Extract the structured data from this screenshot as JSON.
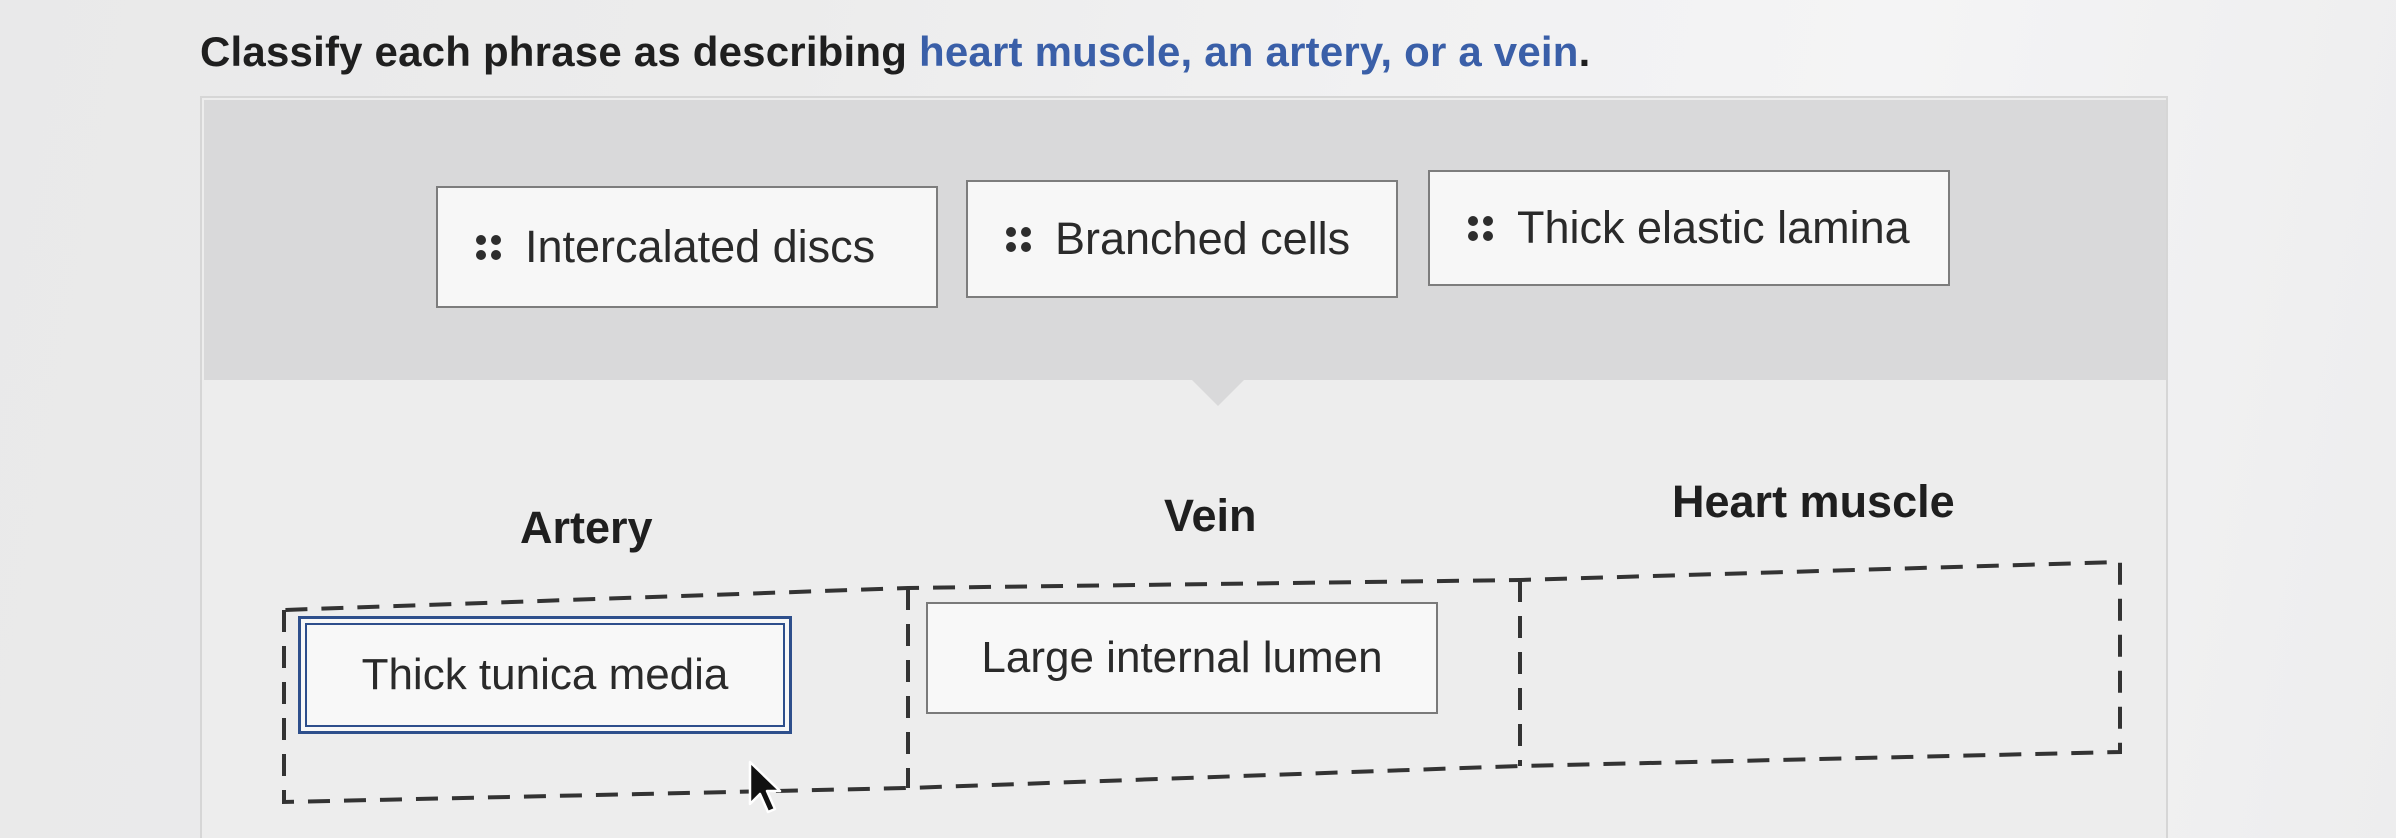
{
  "question": {
    "prefix": "Classify each phrase as describing ",
    "highlight": "heart muscle, an artery, or a vein",
    "suffix": "."
  },
  "word_bank": {
    "items": [
      {
        "label": "Intercalated discs",
        "icon": "drag-handle-icon"
      },
      {
        "label": "Branched cells",
        "icon": "drag-handle-icon"
      },
      {
        "label": "Thick elastic lamina",
        "icon": "drag-handle-icon"
      }
    ]
  },
  "categories": [
    {
      "label": "Artery",
      "placed": [
        "Thick tunica media"
      ]
    },
    {
      "label": "Vein",
      "placed": [
        "Large internal lumen"
      ]
    },
    {
      "label": "Heart muscle",
      "placed": []
    }
  ],
  "colors": {
    "accent_text": "#3a5fa8",
    "focus_border": "#2e4f8c",
    "bank_background": "#d9d9da"
  }
}
